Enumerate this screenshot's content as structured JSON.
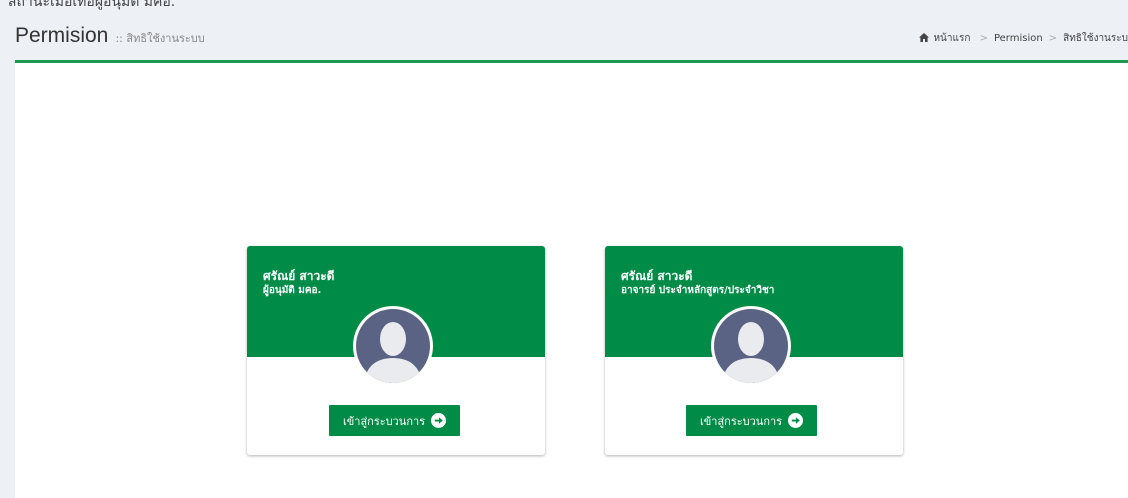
{
  "top_text": "สถานะเมื่อเทือผู้อนุมัติ มคอ.",
  "header": {
    "title": "Permision",
    "subtitle": ":: สิทธิใช้งานระบบ"
  },
  "breadcrumb": [
    {
      "label": "หน้าแรก",
      "icon": "home-icon"
    },
    {
      "label": "Permision"
    },
    {
      "label": "สิทธิใช้งานระบ"
    }
  ],
  "cards": [
    {
      "name": "ศรัณย์ สาวะดี",
      "role": "ผู้อนุมัติ มคอ.",
      "button_label": "เข้าสู่กระบวนการ",
      "icon": "arrow-right-circle-icon"
    },
    {
      "name": "ศรัณย์ สาวะดี",
      "role": "อาจารย์ ประจำหลักสูตร/ประจำวิชา",
      "button_label": "เข้าสู่กระบวนการ",
      "icon": "arrow-right-circle-icon"
    }
  ],
  "colors": {
    "accent_green": "#008c47",
    "header_rule": "#1a9a50",
    "avatar_bg": "#5a6384",
    "page_bg": "#edf0f5"
  }
}
